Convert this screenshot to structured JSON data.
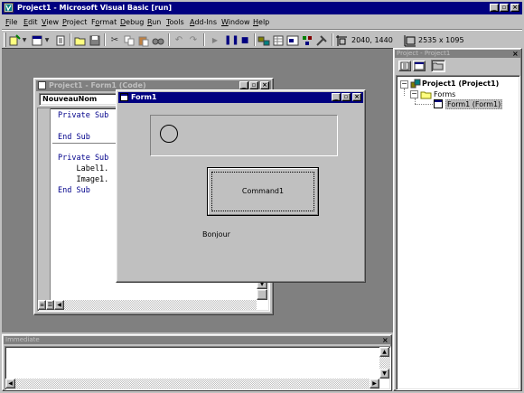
{
  "app": {
    "title": "Project1 - Microsoft Visual Basic [run]"
  },
  "menu": [
    {
      "label": "File",
      "u": "F",
      "rest": "ile"
    },
    {
      "label": "Edit",
      "u": "E",
      "rest": "dit"
    },
    {
      "label": "View",
      "u": "V",
      "rest": "iew"
    },
    {
      "label": "Project",
      "u": "P",
      "rest": "roject"
    },
    {
      "label": "Format",
      "u": "o",
      "pre": "F",
      "rest": "rmat"
    },
    {
      "label": "Debug",
      "u": "D",
      "rest": "ebug"
    },
    {
      "label": "Run",
      "u": "R",
      "rest": "un"
    },
    {
      "label": "Tools",
      "u": "T",
      "rest": "ools"
    },
    {
      "label": "Add-Ins",
      "u": "A",
      "rest": "dd-Ins"
    },
    {
      "label": "Window",
      "u": "W",
      "rest": "indow"
    },
    {
      "label": "Help",
      "u": "H",
      "rest": "elp"
    }
  ],
  "toolbar": {
    "position_readout": "2040, 1440",
    "size_readout": "2535 x 1095"
  },
  "code_window": {
    "title": "Project1 - Form1 (Code)",
    "object_combo": "NouveauNom",
    "lines": [
      {
        "text": "Private Sub",
        "keyword": true
      },
      {
        "text": "",
        "keyword": false
      },
      {
        "text": "End Sub",
        "keyword": true
      },
      {
        "text": "",
        "keyword": false
      },
      {
        "text": "Private Sub",
        "keyword": true
      },
      {
        "text": "    Label1.",
        "keyword": false
      },
      {
        "text": "    Image1.",
        "keyword": false
      },
      {
        "text": "End Sub",
        "keyword": true
      }
    ]
  },
  "form1": {
    "title": "Form1",
    "command_button_label": "Command1",
    "label_text": "Bonjour"
  },
  "project_explorer": {
    "title": "Project - Project1",
    "root": "Project1 (Project1)",
    "folder": "Forms",
    "item": "Form1 (Form1)"
  },
  "immediate": {
    "title": "Immediate"
  },
  "colors": {
    "title_active": "#000080",
    "title_inactive": "#808080",
    "mdi_background": "#808080",
    "face": "#c0c0c0"
  }
}
